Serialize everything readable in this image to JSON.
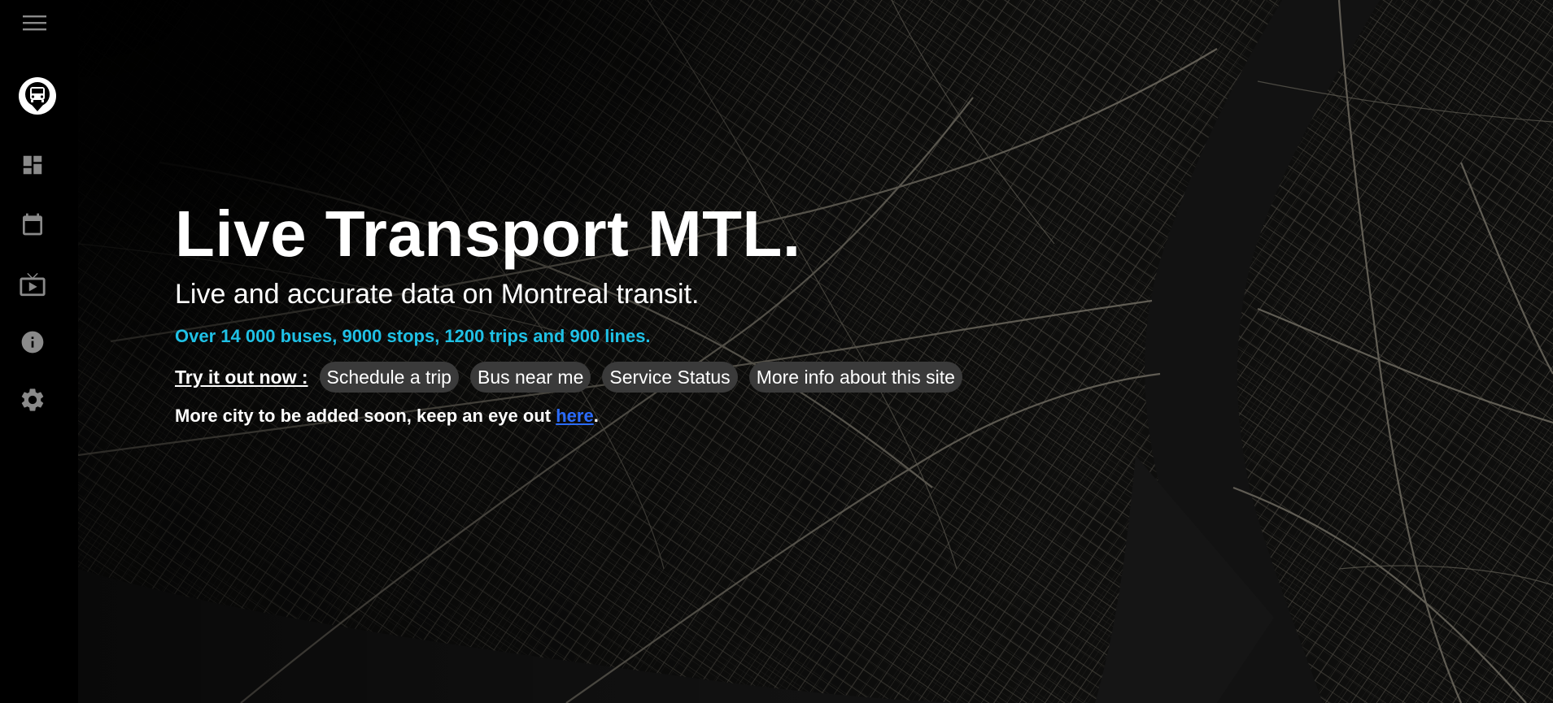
{
  "sidebar": {
    "items": [
      {
        "icon": "menu-icon"
      },
      {
        "icon": "bus-logo-icon"
      },
      {
        "icon": "dashboard-icon"
      },
      {
        "icon": "calendar-icon"
      },
      {
        "icon": "live-tv-icon"
      },
      {
        "icon": "info-icon"
      },
      {
        "icon": "settings-icon"
      }
    ]
  },
  "hero": {
    "title": "Live Transport MTL.",
    "subtitle": "Live and accurate data on Montreal transit.",
    "stats": "Over 14 000 buses, 9000 stops, 1200 trips and 900 lines.",
    "try_label": "Try it out now :",
    "buttons": [
      "Schedule a trip",
      "Bus near me",
      "Service Status",
      "More info about this site"
    ],
    "more_text": "More city to be added soon, keep an eye out ",
    "link_text": "here",
    "more_suffix": "."
  },
  "colors": {
    "accent": "#1fc1e6",
    "link": "#2b6cff",
    "chip_bg": "#3a3a3a",
    "background": "#000000"
  }
}
